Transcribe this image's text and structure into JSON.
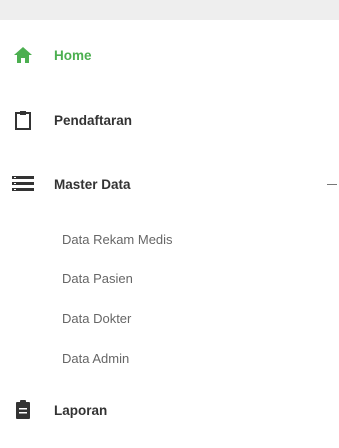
{
  "nav": {
    "home": {
      "label": "Home",
      "icon": "home-icon",
      "active": true
    },
    "pendaftaran": {
      "label": "Pendaftaran",
      "icon": "clipboard-icon"
    },
    "master_data": {
      "label": "Master Data",
      "icon": "menu-list-icon",
      "expanded": true,
      "submenu": [
        {
          "label": "Data Rekam Medis"
        },
        {
          "label": "Data Pasien"
        },
        {
          "label": "Data Dokter"
        },
        {
          "label": "Data Admin"
        }
      ]
    },
    "laporan": {
      "label": "Laporan",
      "icon": "report-icon"
    }
  },
  "colors": {
    "accent": "#4caf50",
    "text": "#333333",
    "subtext": "#666666",
    "icon": "#333333",
    "topbar": "#eeeeee"
  }
}
